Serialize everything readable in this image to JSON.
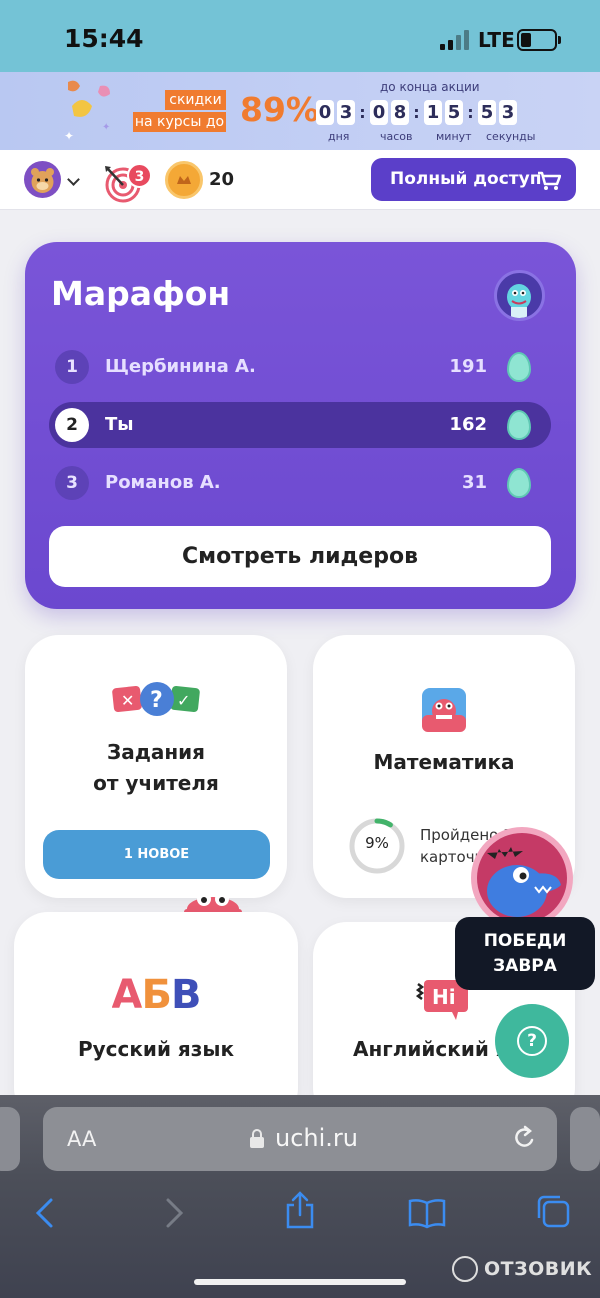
{
  "status": {
    "time": "15:44",
    "network": "LTE"
  },
  "promo": {
    "line1": "скидки",
    "line2": "на курсы до",
    "percent": "89%",
    "caption": "до конца акции",
    "timer": {
      "days": [
        "0",
        "3"
      ],
      "hours": [
        "0",
        "8"
      ],
      "minutes": [
        "1",
        "5"
      ],
      "seconds": [
        "5",
        "3"
      ]
    },
    "labels": {
      "days": "дня",
      "hours": "часов",
      "minutes": "минут",
      "seconds": "секунды"
    }
  },
  "topnav": {
    "tasks_badge": "3",
    "coins": "20",
    "full_access_label": "Полный доступ"
  },
  "marathon": {
    "title": "Марафон",
    "rows": [
      {
        "rank": "1",
        "name": "Щербинина А.",
        "score": "191"
      },
      {
        "rank": "2",
        "name": "Ты",
        "score": "162"
      },
      {
        "rank": "3",
        "name": "Романов А.",
        "score": "31"
      }
    ],
    "leaders_button": "Смотреть лидеров"
  },
  "cards": {
    "teacher": {
      "title_line1": "Задания",
      "title_line2": "от учителя",
      "button": "1 НОВОЕ"
    },
    "math": {
      "title": "Математика",
      "progress_value": "9%",
      "progress_fraction": 0.09,
      "progress_line1": "Пройдено 34",
      "progress_line2": "карточки"
    },
    "russian": {
      "title": "Русский язык",
      "logo": "АБВ"
    },
    "english": {
      "title": "Английский язык",
      "logo": "Hi"
    }
  },
  "floating": {
    "beat_line1": "ПОБЕДИ",
    "beat_line2": "ЗАВРА",
    "help_label": "?"
  },
  "browser": {
    "aa": "AA",
    "url": "uchi.ru"
  },
  "watermark": "ОТЗОВИК",
  "colors": {
    "accent": "#5b3fc9",
    "marathon": "#7a55d8",
    "orange": "#f07b2f",
    "help": "#3fb89d",
    "blue_button": "#4a9cd6"
  }
}
